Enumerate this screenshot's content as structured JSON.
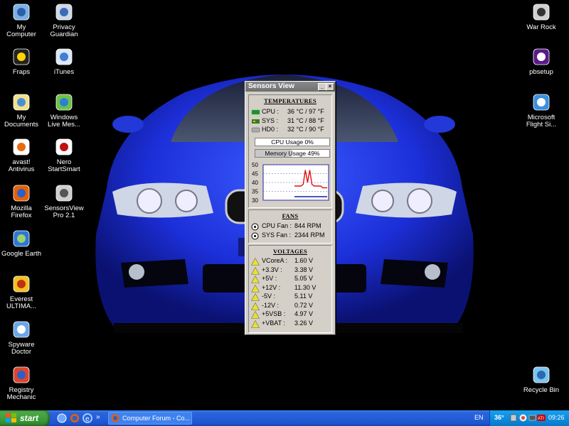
{
  "desktop": {
    "left_icons": [
      {
        "label": "My\nComputer",
        "icon": "my-computer-icon"
      },
      {
        "label": "Privacy\nGuardian",
        "icon": "privacy-guardian-icon"
      },
      {
        "label": "Fraps",
        "icon": "fraps-icon"
      },
      {
        "label": "iTunes",
        "icon": "itunes-icon"
      },
      {
        "label": "My\nDocuments",
        "icon": "my-documents-icon"
      },
      {
        "label": "Windows\nLive Mes...",
        "icon": "windows-live-messenger-icon"
      },
      {
        "label": "avast!\nAntivirus",
        "icon": "avast-icon"
      },
      {
        "label": "Nero\nStartSmart",
        "icon": "nero-icon"
      },
      {
        "label": "Mozilla\nFirefox",
        "icon": "firefox-icon"
      },
      {
        "label": "SensorsView\nPro 2.1",
        "icon": "sensorsview-icon"
      },
      {
        "label": "Google Earth",
        "icon": "google-earth-icon"
      },
      {
        "label": "Everest\nULTIMA...",
        "icon": "everest-icon"
      },
      {
        "label": "Spyware\nDoctor",
        "icon": "spyware-doctor-icon"
      },
      {
        "label": "Registry\nMechanic",
        "icon": "registry-mechanic-icon"
      }
    ],
    "right_icons": [
      {
        "label": "War Rock",
        "icon": "war-rock-icon"
      },
      {
        "label": "pbsetup",
        "icon": "pbsetup-icon"
      },
      {
        "label": "Microsoft\nFlight Si...",
        "icon": "flight-simulator-icon"
      },
      {
        "label": "Recycle Bin",
        "icon": "recycle-bin-icon"
      }
    ]
  },
  "sensors_window": {
    "title": "Sensors View",
    "temperatures": {
      "heading": "TEMPERATURES",
      "rows": [
        {
          "label": "CPU :",
          "value": "36 °C / 97 °F"
        },
        {
          "label": "SYS :",
          "value": "31 °C / 88 °F"
        },
        {
          "label": "HD0 :",
          "value": "32 °C / 90 °F"
        }
      ]
    },
    "cpu_usage": {
      "label": "CPU Usage 0%",
      "percent": 0
    },
    "memory_usage": {
      "label": "Memory Usage 49%",
      "percent": 49
    },
    "graph": {
      "y_ticks": [
        "50",
        "45",
        "40",
        "35",
        "30"
      ],
      "ymin": 30,
      "ymax": 50,
      "red_series": [
        38,
        38,
        38,
        38,
        39,
        47,
        40,
        47,
        39,
        38,
        38,
        38,
        38,
        37,
        37,
        37
      ],
      "blue_series": [
        32,
        32,
        32,
        32,
        32,
        32,
        32,
        32,
        32,
        32,
        32,
        32,
        32,
        32,
        32,
        32
      ],
      "red_color": "#e01010",
      "blue_color": "#1020a0"
    },
    "fans": {
      "heading": "FANS",
      "rows": [
        {
          "label": "CPU Fan :",
          "value": "844 RPM"
        },
        {
          "label": "SYS Fan :",
          "value": "2344 RPM"
        }
      ]
    },
    "voltages": {
      "heading": "VOLTAGES",
      "rows": [
        {
          "label": "VCoreA :",
          "value": "1.60 V"
        },
        {
          "label": "+3.3V :",
          "value": "3.38 V"
        },
        {
          "label": "+5V :",
          "value": "5.05 V"
        },
        {
          "label": "+12V :",
          "value": "11.30 V"
        },
        {
          "label": "-5V :",
          "value": "5.11 V"
        },
        {
          "label": "-12V :",
          "value": "0.72 V"
        },
        {
          "label": "+5VSB :",
          "value": "4.97 V"
        },
        {
          "label": "+VBAT :",
          "value": "3.26 V"
        }
      ]
    }
  },
  "taskbar": {
    "start_label": "start",
    "task_item": "Computer Forum - Co...",
    "tray": {
      "lang": "EN",
      "temp": "36°",
      "time": "09:26"
    },
    "colors": {
      "taskbar_blue": "#245edb",
      "start_green": "#3c9a3a"
    }
  }
}
